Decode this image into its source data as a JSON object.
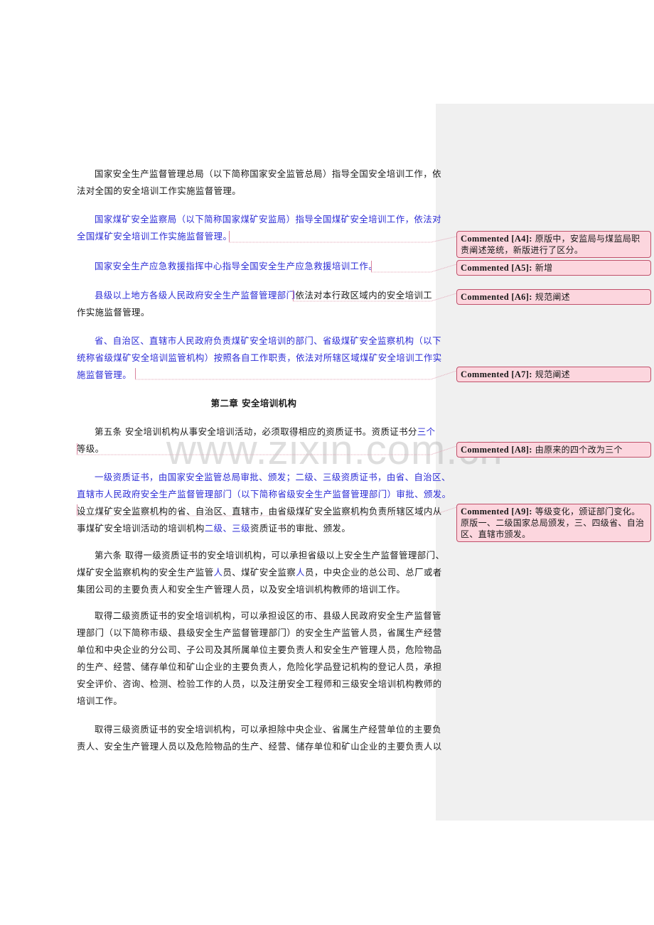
{
  "document": {
    "paragraphs": [
      {
        "id": "p1",
        "lines": [
          [
            {
              "t": "国家安全生产监督管理总局（以下简称国家安全监管总局）指导全国安全培训工作，依",
              "c": "normal"
            }
          ],
          [
            {
              "t": "法对全国的安全培训工作实施监督管理。",
              "c": "normal"
            }
          ]
        ]
      },
      {
        "id": "p2",
        "lines": [
          [
            {
              "t": "国家煤矿安全监察局（以下简称国家煤矿安监局）指导全国煤矿安全培训工作，依法对",
              "c": "blue"
            }
          ],
          [
            {
              "t": "全国煤矿安全培训工作实施监督管理。",
              "c": "blue"
            }
          ]
        ]
      },
      {
        "id": "p3",
        "lines": [
          [
            {
              "t": "国家安全生产应急救援指挥中心指导全国安全生产应急救援培训工作。",
              "c": "blue"
            }
          ]
        ]
      },
      {
        "id": "p4",
        "lines": [
          [
            {
              "t": "县级以上地方各级人民政府安全生产监督管理部门",
              "c": "blue"
            },
            {
              "t": "依法对本行政区域内的安全培训工",
              "c": "normal"
            }
          ],
          [
            {
              "t": "作实施监督管理。",
              "c": "normal"
            }
          ]
        ]
      },
      {
        "id": "p5",
        "lines": [
          [
            {
              "t": "省、自治区、直辖市人民政府负责煤矿安全培训的部门、省级煤矿安全监察机构（以下",
              "c": "blue"
            }
          ],
          [
            {
              "t": "统称省级煤矿安全培训监管机构）按照各自工作职责，依法对所辖区域煤矿安全培训工作实",
              "c": "blue"
            }
          ],
          [
            {
              "t": "施监督管理。",
              "c": "blue"
            }
          ]
        ]
      },
      {
        "id": "p6",
        "lines": [
          [
            {
              "t": "第五条  安全培训机构从事安全培训活动，必须取得相应的资质证书。资质证书分",
              "c": "normal"
            },
            {
              "t": "三个",
              "c": "blue"
            }
          ],
          [
            {
              "t": "等级。",
              "c": "normal"
            }
          ]
        ]
      },
      {
        "id": "p7",
        "lines": [
          [
            {
              "t": "一级资质证书，由国家安全监管总局审批、颁发；二级、三级资质证书，由省、自治区、",
              "c": "blue"
            }
          ],
          [
            {
              "t": "直辖市人民政府安全生产监督管理部门（以下简称省级安全生产监督管理部门）审批、颁发。",
              "c": "blue"
            }
          ],
          [
            {
              "t": "设立煤矿安全监察机构的省、自治区、直辖市，由省级煤矿安全监察机构负责所辖区域内从",
              "c": "normal"
            }
          ],
          [
            {
              "t": "事煤矿安全培训活动的培训机构",
              "c": "normal"
            },
            {
              "t": "二级、三级",
              "c": "blue"
            },
            {
              "t": "资质证书的审批、颁发。",
              "c": "normal"
            }
          ]
        ]
      },
      {
        "id": "p8",
        "lines": [
          [
            {
              "t": "第六条  取得一级资质证书的安全培训机构，可以承担省级以上安全生产监督管理部门、",
              "c": "normal"
            }
          ],
          [
            {
              "t": "煤矿安全监察机构的安全生产监管",
              "c": "normal"
            },
            {
              "t": "人",
              "c": "blue"
            },
            {
              "t": "员、煤矿安全监察",
              "c": "normal"
            },
            {
              "t": "人",
              "c": "blue"
            },
            {
              "t": "员，中央企业的总公司、总厂或者",
              "c": "normal"
            }
          ],
          [
            {
              "t": "集团公司的主要负责人和安全生产管理人员，以及安全培训机构教师的培训工作。",
              "c": "normal"
            }
          ]
        ]
      },
      {
        "id": "p9",
        "lines": [
          [
            {
              "t": "取得二级资质证书的安全培训机构，可以承担设区的市、县级人民政府安全生产监督管",
              "c": "normal"
            }
          ],
          [
            {
              "t": "理部门（以下简称市级、县级安全生产监督管理部门）的安全生产监管人员，省属生产经营",
              "c": "normal"
            }
          ],
          [
            {
              "t": "单位和中央企业的分公司、子公司及其所属单位主要负责人和安全生产管理人员，危险物品",
              "c": "normal"
            }
          ],
          [
            {
              "t": "的生产、经营、储存单位和矿山企业的主要负责人，危险化学品登记机构的登记人员，承担",
              "c": "normal"
            }
          ],
          [
            {
              "t": "安全评价、咨询、检测、检验工作的人员，以及注册安全工程师和三级安全培训机构教师的",
              "c": "normal"
            }
          ],
          [
            {
              "t": "培训工作。",
              "c": "normal"
            }
          ]
        ]
      },
      {
        "id": "p10",
        "lines": [
          [
            {
              "t": "取得三级资质证书的安全培训机构，可以承担除中央企业、省属生产经营单位的主要负",
              "c": "normal"
            }
          ],
          [
            {
              "t": "责人、安全生产管理人员以及危险物品的生产、经营、储存单位和矿山企业的主要负责人以",
              "c": "normal"
            }
          ]
        ]
      }
    ],
    "chapter_heading": "第二章  安全培训机构"
  },
  "comments": [
    {
      "tag": "Commented [A4]:",
      "text": "原版中，安监局与煤监局职责阐述笼统，新版进行了区分。"
    },
    {
      "tag": "Commented [A5]:",
      "text": "新增"
    },
    {
      "tag": "Commented [A6]:",
      "text": "规范阐述"
    },
    {
      "tag": "Commented [A7]:",
      "text": "规范阐述"
    },
    {
      "tag": "Commented [A8]:",
      "text": "由原来的四个改为三个"
    },
    {
      "tag": "Commented [A9]:",
      "text": "等级变化，颁证部门变化。原版一、二级国家总局颁发，三、四级省、自治区、直辖市颁发。"
    }
  ],
  "watermark": "www.zixin.com.cn",
  "colors": {
    "revision_text": "#2b2bd6",
    "comment_fill": "#fcd6de",
    "comment_border": "#c0506a",
    "comment_pane": "#f0f0f0",
    "connector": "#e3a5b6"
  }
}
